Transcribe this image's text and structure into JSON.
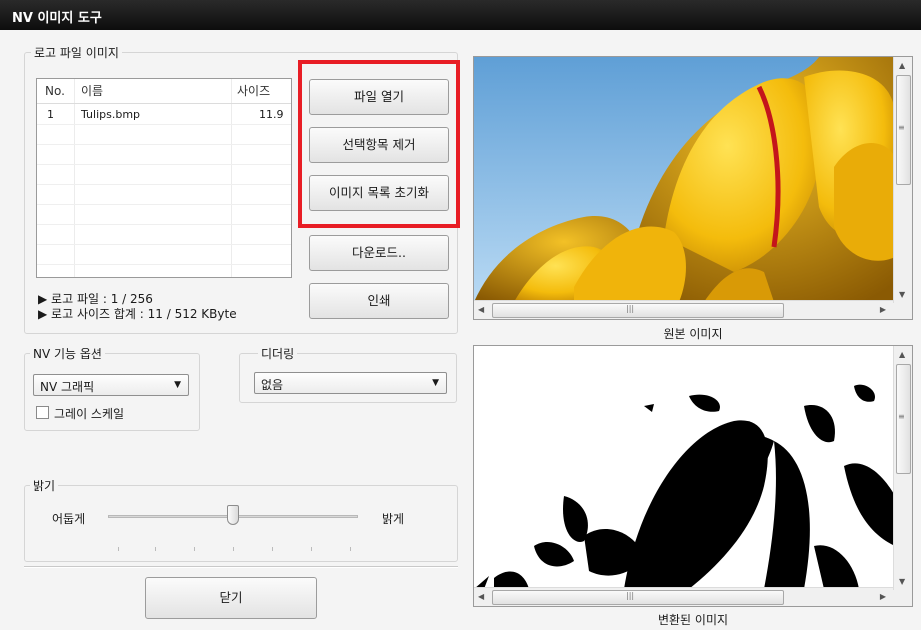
{
  "window": {
    "title": "NV 이미지 도구"
  },
  "logo_panel": {
    "group_label": "로고 파일 이미지",
    "columns": [
      "No.",
      "이름",
      "사이즈"
    ],
    "rows": [
      {
        "no": "1",
        "name": "Tulips.bmp",
        "size": "11.9"
      }
    ],
    "info_file_count": "▶ 로고 파일 : 1 / 256",
    "info_size_total": "▶ 로고 사이즈 합계 : 11 / 512 KByte"
  },
  "buttons": {
    "open_file": "파일 열기",
    "remove_selected": "선택항목 제거",
    "reset_list": "이미지 목록 초기화",
    "download": "다운로드..",
    "print": "인쇄",
    "close": "닫기"
  },
  "options": {
    "nv_group_label": "NV 기능 옵션",
    "nv_select_value": "NV 그래픽",
    "grayscale_label": "그레이 스케일",
    "grayscale_checked": false,
    "dither_group_label": "디더링",
    "dither_select_value": "없음"
  },
  "brightness": {
    "group_label": "밝기",
    "dark_label": "어둡게",
    "bright_label": "밝게",
    "level": 0.5
  },
  "images": {
    "original_caption": "원본 이미지",
    "converted_caption": "변환된 이미지"
  },
  "colors": {
    "highlight_red": "#e81d25",
    "sky_blue": "#8cc1ec",
    "tulip_yellow": "#f5c20f"
  }
}
